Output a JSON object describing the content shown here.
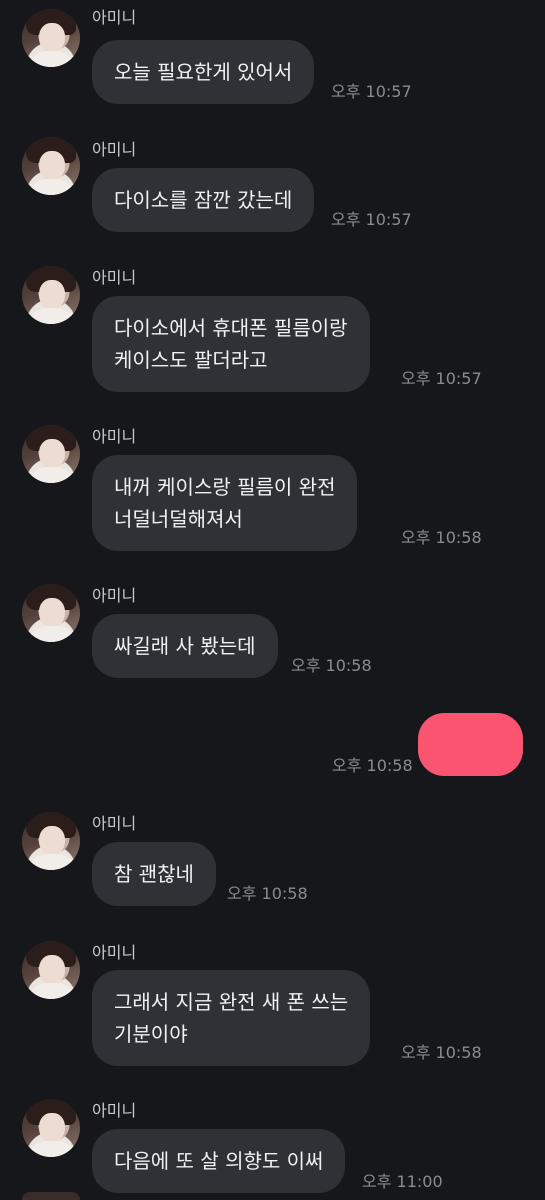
{
  "sender": {
    "name": "아미니",
    "avatar_icon": "profile-photo-avatar"
  },
  "colors": {
    "background": "#16171b",
    "received_bubble": "#2f3137",
    "sent_bubble": "#fb5470",
    "text": "#f1f1f3",
    "time": "#8b8c90"
  },
  "messages": [
    {
      "from": "other",
      "lines": [
        "오늘 필요한게 있어서"
      ],
      "time": "오후 10:57"
    },
    {
      "from": "other",
      "lines": [
        "다이소를 잠깐 갔는데"
      ],
      "time": "오후 10:57"
    },
    {
      "from": "other",
      "lines": [
        "다이소에서 휴대폰 필름이랑",
        "케이스도 팔더라고"
      ],
      "time": "오후 10:57"
    },
    {
      "from": "other",
      "lines": [
        "내꺼 케이스랑 필름이 완전",
        "너덜너덜해져서"
      ],
      "time": "오후 10:58"
    },
    {
      "from": "other",
      "lines": [
        "싸길래 사 봤는데"
      ],
      "time": "오후 10:58"
    },
    {
      "from": "me",
      "lines": [],
      "time": "오후 10:58"
    },
    {
      "from": "other",
      "lines": [
        "참 괜찮네"
      ],
      "time": "오후 10:58"
    },
    {
      "from": "other",
      "lines": [
        "그래서 지금 완전 새 폰 쓰는",
        "기분이야"
      ],
      "time": "오후 10:58"
    },
    {
      "from": "other",
      "lines": [
        "다음에 또 살 의향도 이써"
      ],
      "time": "오후 11:00"
    }
  ]
}
